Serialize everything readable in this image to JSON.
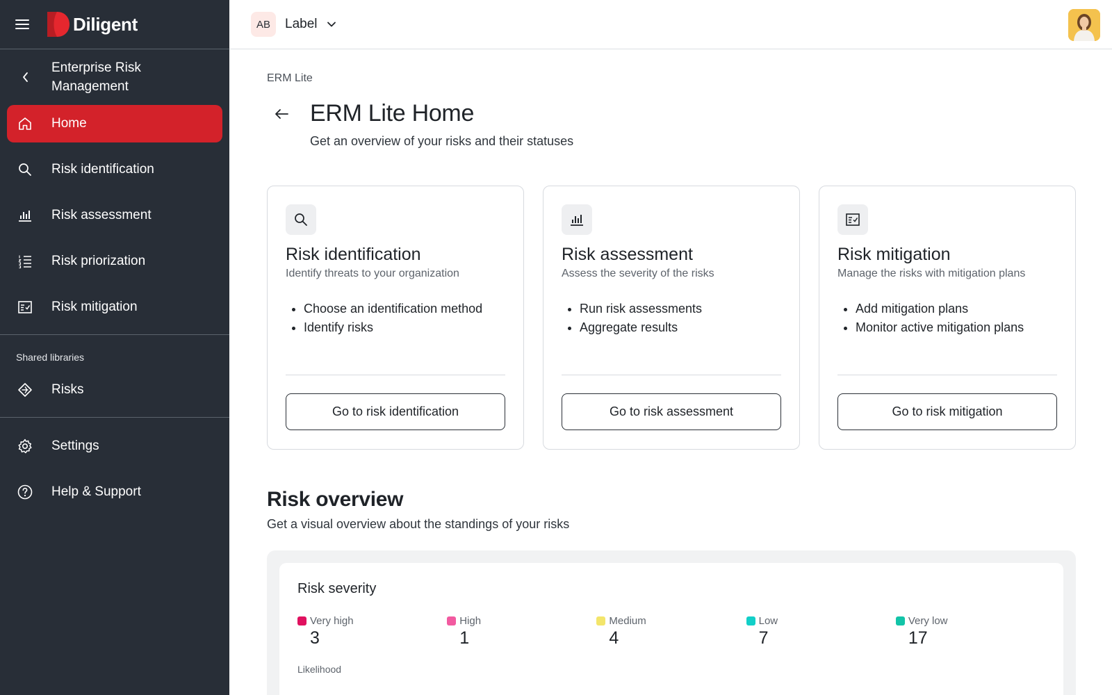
{
  "app": {
    "brand_name": "Diligent",
    "brand_color": "#d3222a"
  },
  "sidebar": {
    "module_title": "Enterprise Risk Management",
    "nav_items": [
      {
        "label": "Home",
        "icon": "home-icon",
        "active": true
      },
      {
        "label": "Risk identification",
        "icon": "search-icon"
      },
      {
        "label": "Risk assessment",
        "icon": "bar-chart-icon"
      },
      {
        "label": "Risk priorization",
        "icon": "numbered-list-icon"
      },
      {
        "label": "Risk mitigation",
        "icon": "checklist-icon"
      }
    ],
    "shared_section_title": "Shared libraries",
    "shared_items": [
      {
        "label": "Risks",
        "icon": "diamond-icon"
      }
    ],
    "footer_items": [
      {
        "label": "Settings",
        "icon": "gear-icon"
      },
      {
        "label": "Help & Support",
        "icon": "help-circle-icon"
      }
    ]
  },
  "topbar": {
    "org_initials": "AB",
    "org_label": "Label",
    "user_avatar": "user-photo"
  },
  "main": {
    "breadcrumb": "ERM Lite",
    "title": "ERM Lite Home",
    "subtitle": "Get an overview of your risks and their statuses",
    "cards": [
      {
        "icon": "search-icon",
        "title": "Risk identification",
        "description": "Identify threats to your organization",
        "bullets": [
          "Choose an identification method",
          "Identify risks"
        ],
        "button": "Go to risk identification"
      },
      {
        "icon": "bar-chart-icon",
        "title": "Risk assessment",
        "description": "Assess the severity of the risks",
        "bullets": [
          "Run risk assessments",
          "Aggregate results"
        ],
        "button": "Go to risk assessment"
      },
      {
        "icon": "checklist-icon",
        "title": "Risk mitigation",
        "description": "Manage the risks with mitigation plans",
        "bullets": [
          "Add mitigation plans",
          "Monitor active mitigation plans"
        ],
        "button": "Go to risk mitigation"
      }
    ],
    "overview": {
      "title": "Risk overview",
      "subtitle": "Get a visual overview about the standings of your risks",
      "severity": {
        "title": "Risk severity",
        "levels": [
          {
            "label": "Very high",
            "count": "3",
            "color": "#e0115f"
          },
          {
            "label": "High",
            "count": "1",
            "color": "#f25aa0"
          },
          {
            "label": "Medium",
            "count": "4",
            "color": "#f3e56b"
          },
          {
            "label": "Low",
            "count": "7",
            "color": "#12cfc8"
          },
          {
            "label": "Very low",
            "count": "17",
            "color": "#12c4a8"
          }
        ],
        "axis_label": "Likelihood"
      }
    }
  }
}
